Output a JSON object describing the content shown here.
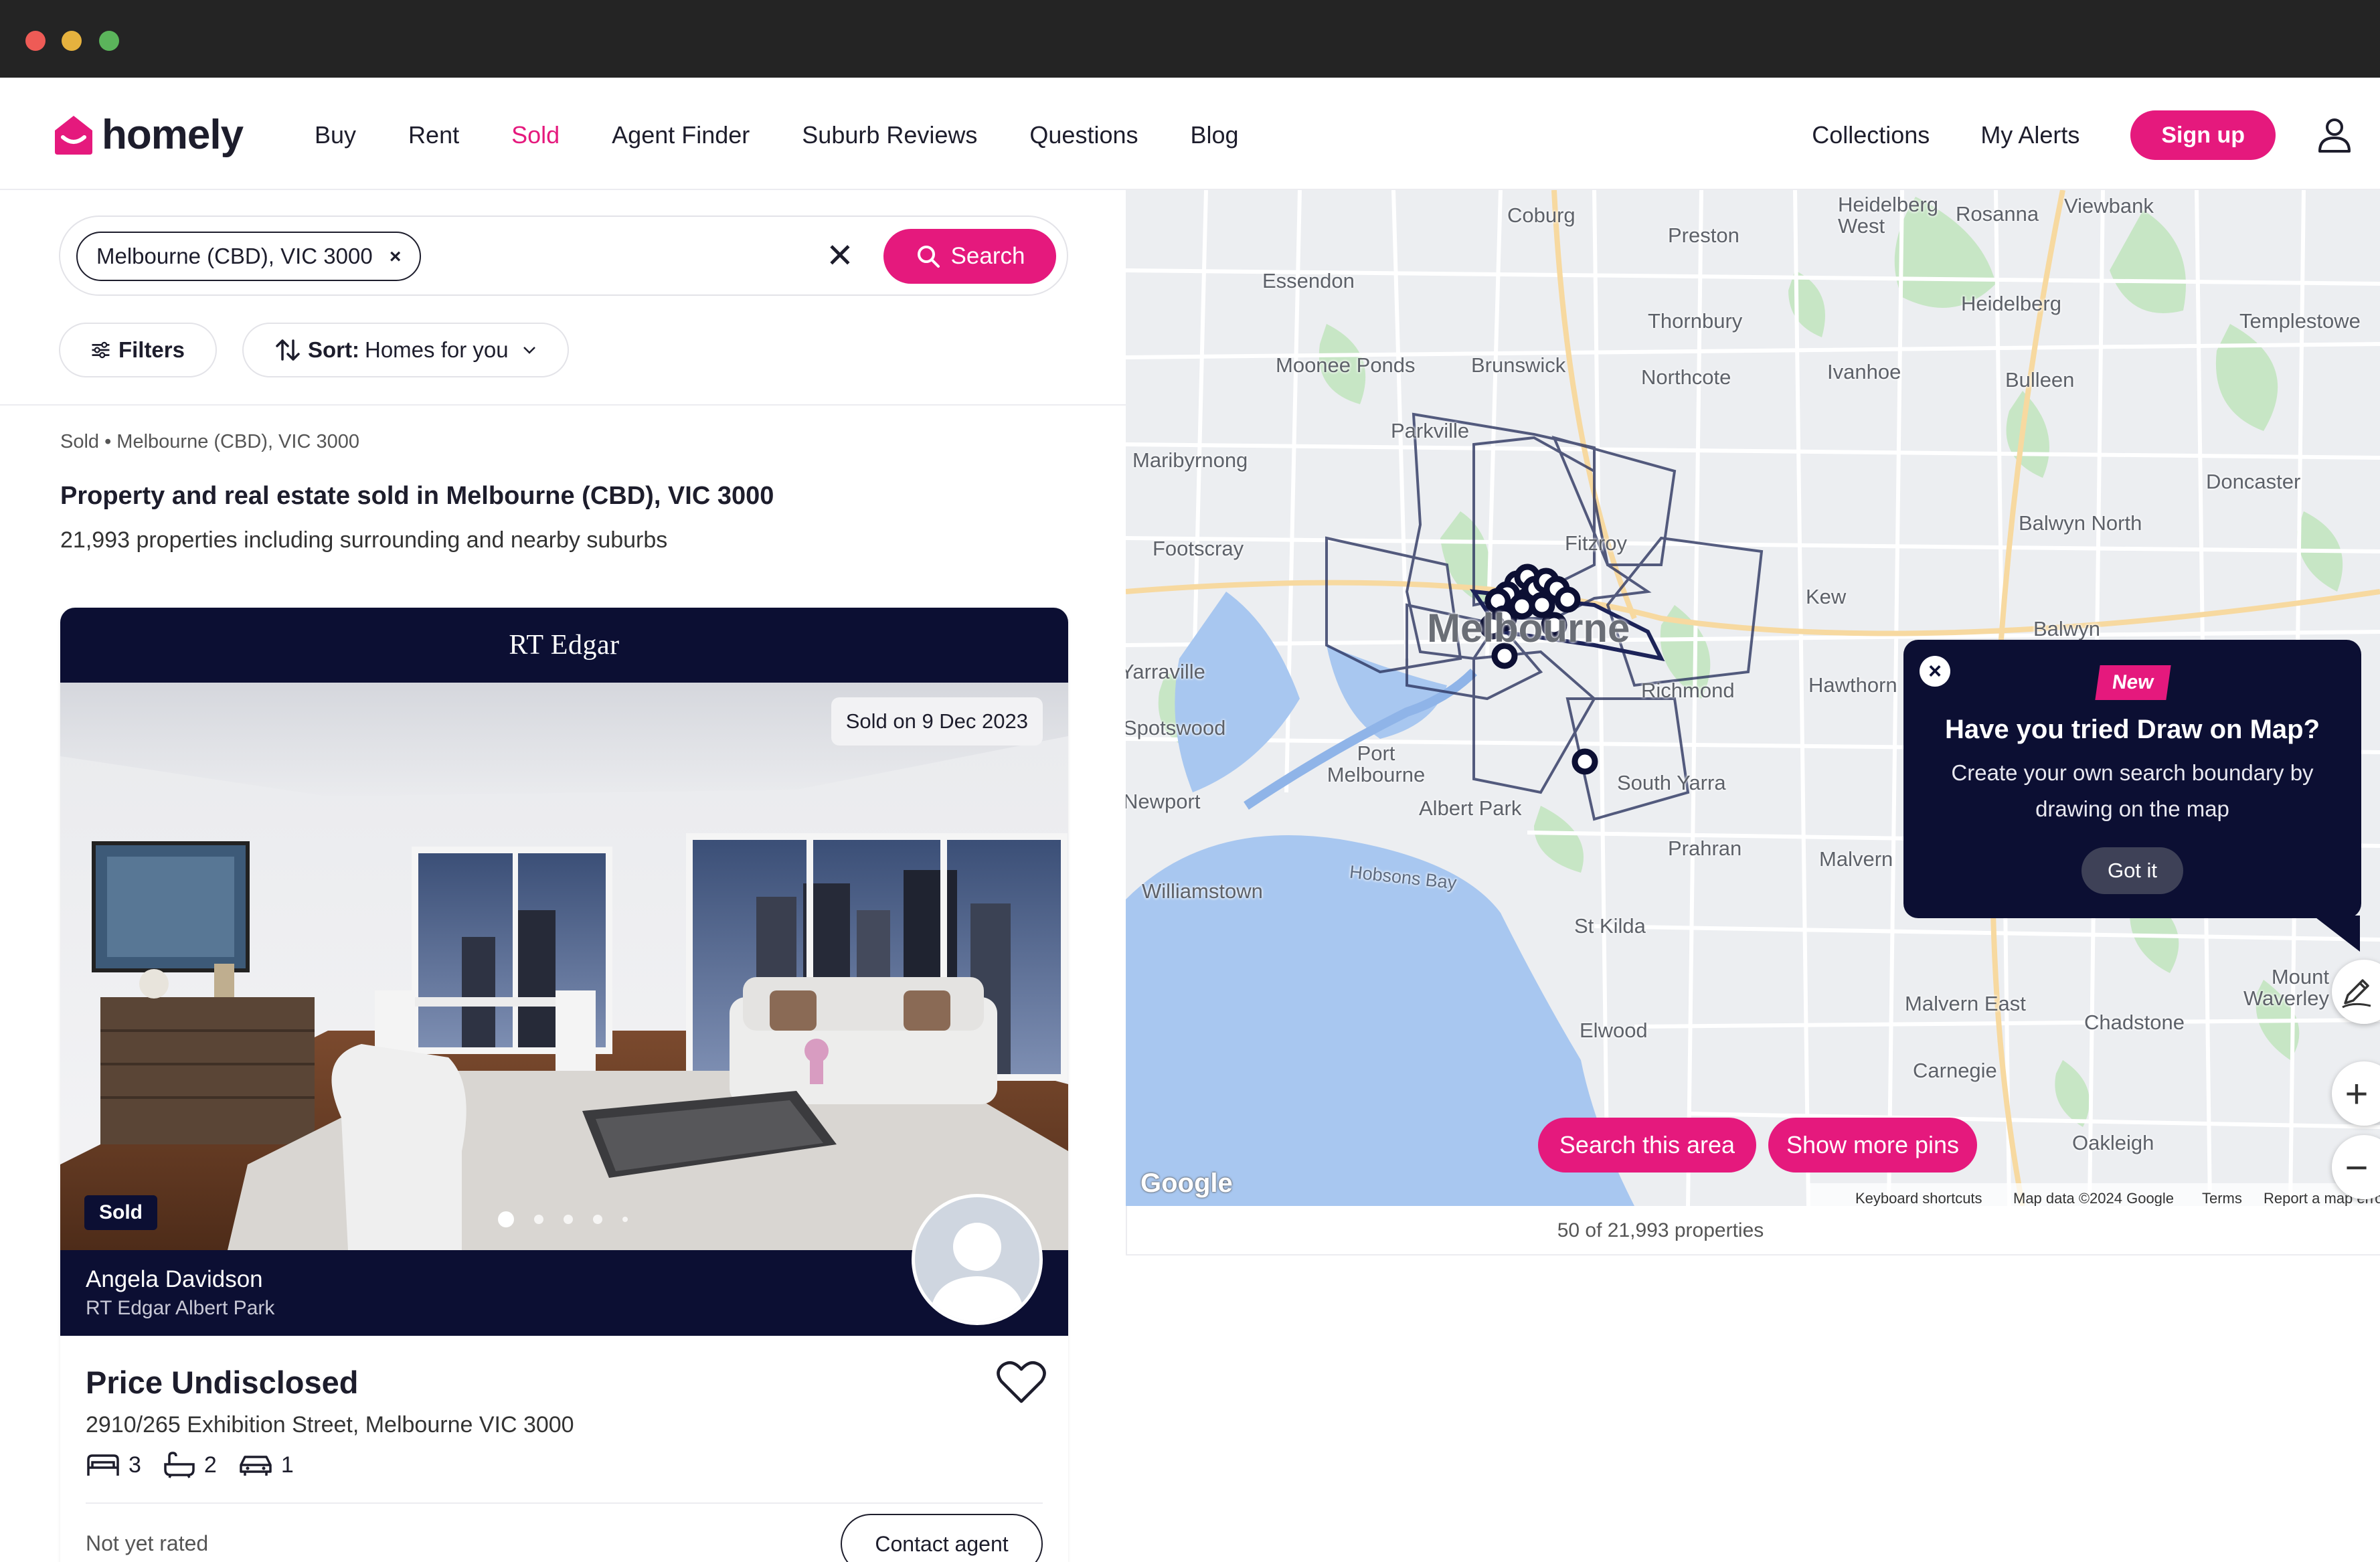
{
  "header": {
    "logo_text": "homely",
    "nav": [
      "Buy",
      "Rent",
      "Sold",
      "Agent Finder",
      "Suburb Reviews",
      "Questions",
      "Blog"
    ],
    "active_nav": "Sold",
    "collections": "Collections",
    "my_alerts": "My Alerts",
    "sign_up": "Sign up",
    "accent_color": "#e5197d",
    "navy_color": "#0c0f33"
  },
  "search": {
    "chip": "Melbourne (CBD), VIC 3000",
    "button": "Search",
    "filters": "Filters",
    "sort_label": "Sort:",
    "sort_value": "Homes for you"
  },
  "results": {
    "breadcrumb": "Sold • Melbourne (CBD), VIC 3000",
    "title": "Property and real estate sold in Melbourne (CBD), VIC 3000",
    "count": "21,993 properties including surrounding and nearby suburbs"
  },
  "listing": {
    "agency": "RT Edgar",
    "sold_date": "Sold on 9 Dec 2023",
    "badge": "Sold",
    "agent_name": "Angela Davidson",
    "agent_agency": "RT Edgar Albert Park",
    "price": "Price Undisclosed",
    "address": "2910/265 Exhibition Street, Melbourne VIC 3000",
    "beds": "3",
    "baths": "2",
    "cars": "1",
    "rating": "Not yet rated",
    "contact": "Contact agent",
    "photo_count": 5,
    "photo_index": 1
  },
  "map": {
    "labels": [
      "Coburg",
      "Preston",
      "Heidelberg West",
      "Rosanna",
      "Viewbank",
      "Essendon",
      "Heidelberg",
      "Thornbury",
      "Templestowe",
      "Moonee Ponds",
      "Brunswick",
      "Northcote",
      "Ivanhoe",
      "Bulleen",
      "Parkville",
      "Maribyrnong",
      "Doncaster",
      "Balwyn North",
      "Footscray",
      "Fitzroy",
      "Kew",
      "Balwyn",
      "Melbourne",
      "Yarraville",
      "Richmond",
      "Hawthorn",
      "Spotswood",
      "Port Melbourne",
      "South Yarra",
      "Newport",
      "Albert Park",
      "Prahran",
      "Malvern",
      "Williamstown",
      "Hobsons Bay",
      "St Kilda",
      "Mount Waverley",
      "Malvern East",
      "Chadstone",
      "Elwood",
      "Carnegie",
      "Oakleigh"
    ],
    "search_area": "Search this area",
    "show_more": "Show more pins",
    "google": "Google",
    "footer": [
      "Keyboard shortcuts",
      "Map data ©2024 Google",
      "Terms",
      "Report a map error"
    ],
    "results_count": "50 of 21,993 properties"
  },
  "popup": {
    "badge": "New",
    "title": "Have you tried Draw on Map?",
    "body": "Create your own search boundary by drawing on the map",
    "button": "Got it"
  }
}
